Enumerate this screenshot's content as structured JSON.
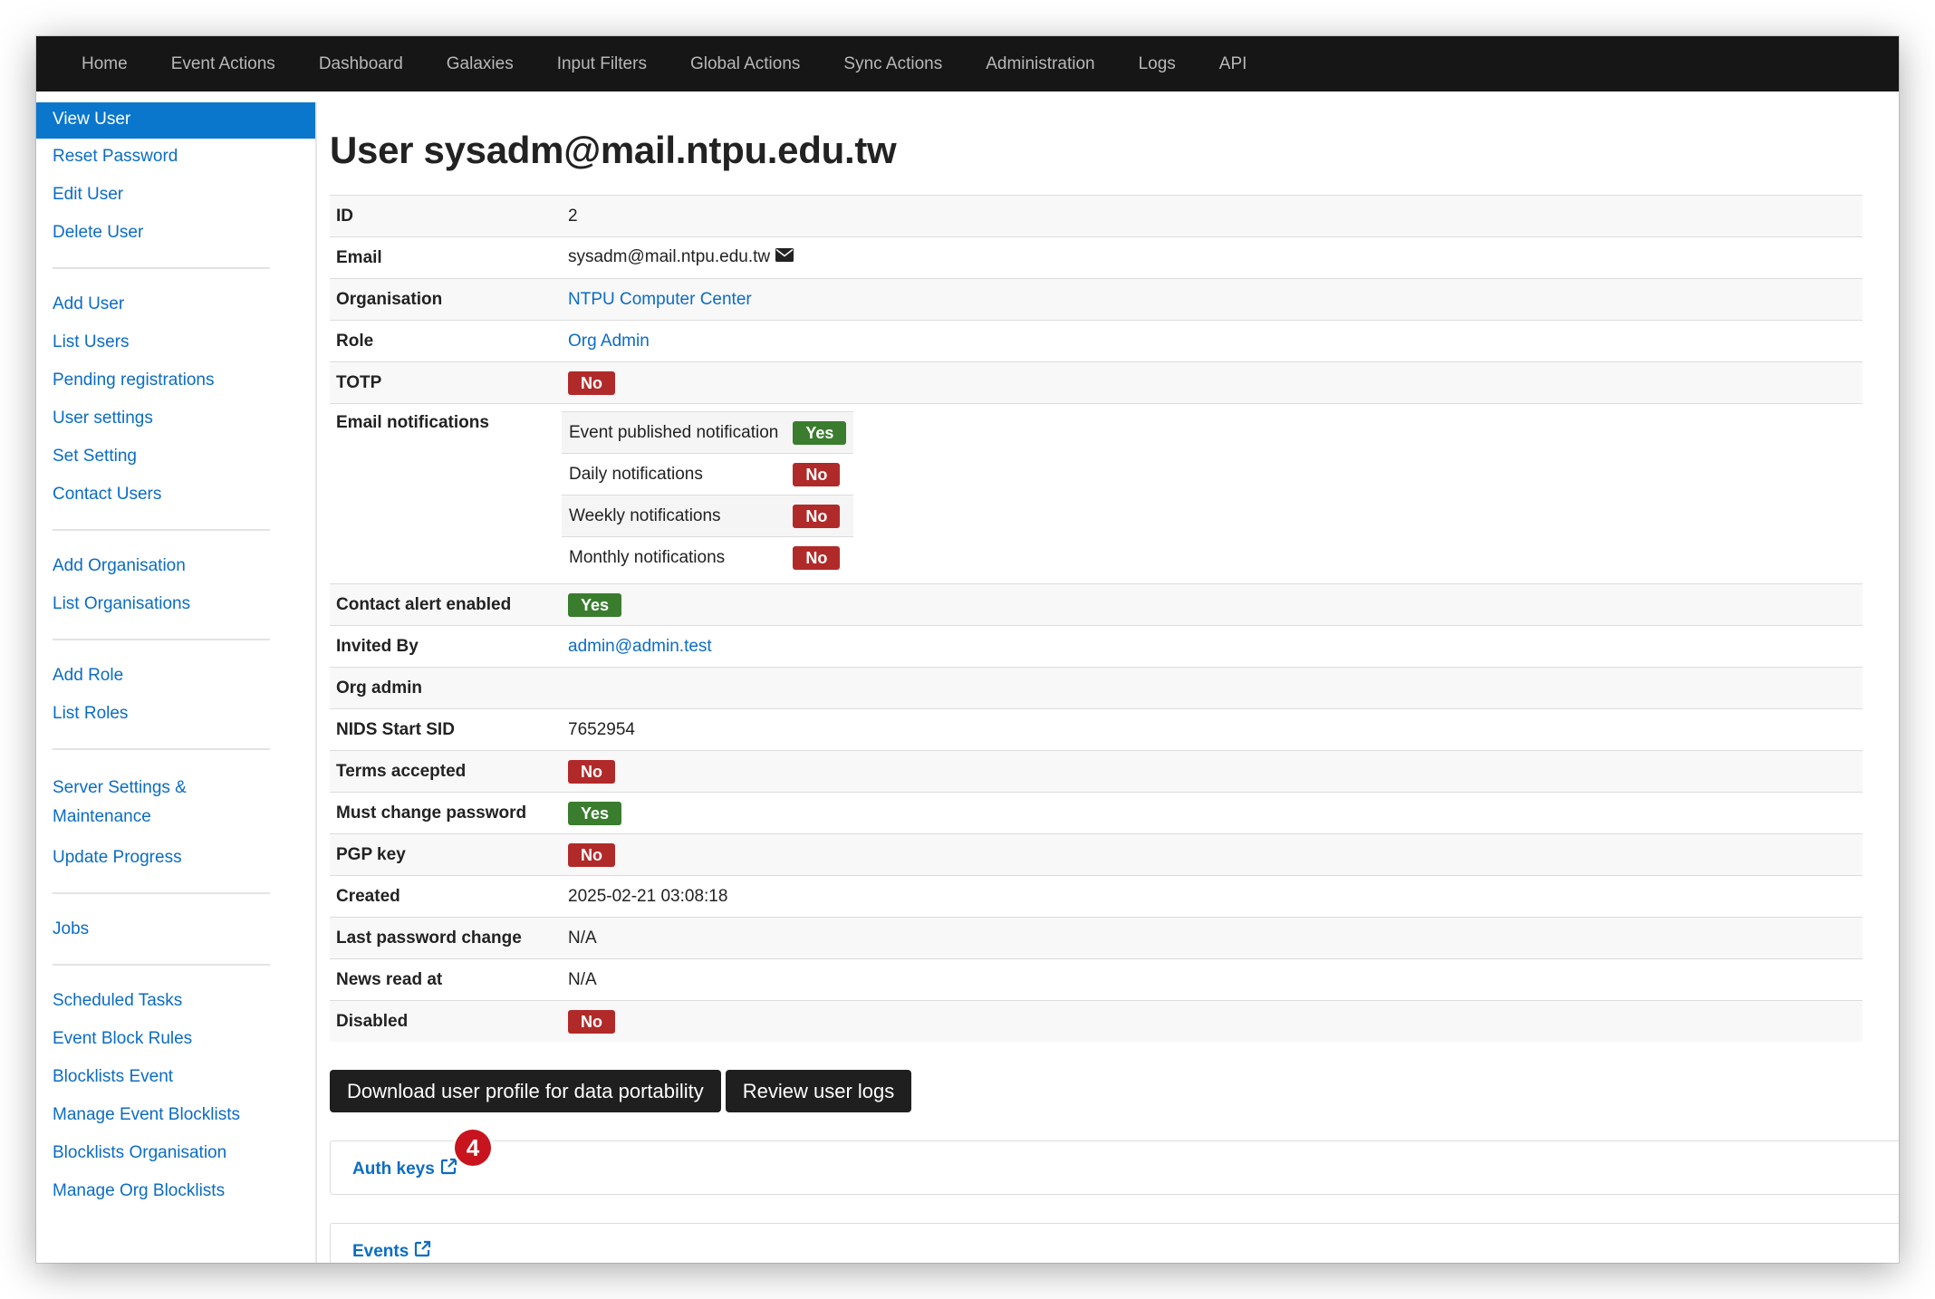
{
  "nav": {
    "items": [
      "Home",
      "Event Actions",
      "Dashboard",
      "Galaxies",
      "Input Filters",
      "Global Actions",
      "Sync Actions",
      "Administration",
      "Logs",
      "API"
    ]
  },
  "sidebar": {
    "groups": [
      [
        "View User",
        "Reset Password",
        "Edit User",
        "Delete User"
      ],
      [
        "Add User",
        "List Users",
        "Pending registrations",
        "User settings",
        "Set Setting",
        "Contact Users"
      ],
      [
        "Add Organisation",
        "List Organisations"
      ],
      [
        "Add Role",
        "List Roles"
      ],
      [
        "Server Settings & Maintenance",
        "Update Progress"
      ],
      [
        "Jobs"
      ],
      [
        "Scheduled Tasks",
        "Event Block Rules",
        "Blocklists Event",
        "Manage Event Blocklists",
        "Blocklists Organisation",
        "Manage Org Blocklists"
      ]
    ],
    "active": "View User"
  },
  "page": {
    "title": "User sysadm@mail.ntpu.edu.tw"
  },
  "details": {
    "id_label": "ID",
    "id": "2",
    "email_label": "Email",
    "email": "sysadm@mail.ntpu.edu.tw",
    "org_label": "Organisation",
    "org": "NTPU Computer Center",
    "role_label": "Role",
    "role": "Org Admin",
    "totp_label": "TOTP",
    "totp": "No",
    "notif_label": "Email notifications",
    "notifications": [
      {
        "label": "Event published notification",
        "value": "Yes"
      },
      {
        "label": "Daily notifications",
        "value": "No"
      },
      {
        "label": "Weekly notifications",
        "value": "No"
      },
      {
        "label": "Monthly notifications",
        "value": "No"
      }
    ],
    "contact_alert_label": "Contact alert enabled",
    "contact_alert": "Yes",
    "invited_by_label": "Invited By",
    "invited_by": "admin@admin.test",
    "org_admin_label": "Org admin",
    "nids_label": "NIDS Start SID",
    "nids": "7652954",
    "terms_label": "Terms accepted",
    "terms": "No",
    "must_change_label": "Must change password",
    "must_change": "Yes",
    "pgp_label": "PGP key",
    "pgp": "No",
    "created_label": "Created",
    "created": "2025-02-21 03:08:18",
    "last_pw_label": "Last password change",
    "last_pw": "N/A",
    "news_label": "News read at",
    "news": "N/A",
    "disabled_label": "Disabled",
    "disabled": "No"
  },
  "buttons": {
    "download": "Download user profile for data portability",
    "review_logs": "Review user logs"
  },
  "panels": {
    "auth_keys": "Auth keys",
    "auth_keys_count": "4",
    "events": "Events"
  },
  "colors": {
    "no": "#b12a2a",
    "yes": "#3a7d2e",
    "link": "#0b6cc4",
    "nav_bg": "#161616",
    "active_bg": "#0a77cc"
  }
}
